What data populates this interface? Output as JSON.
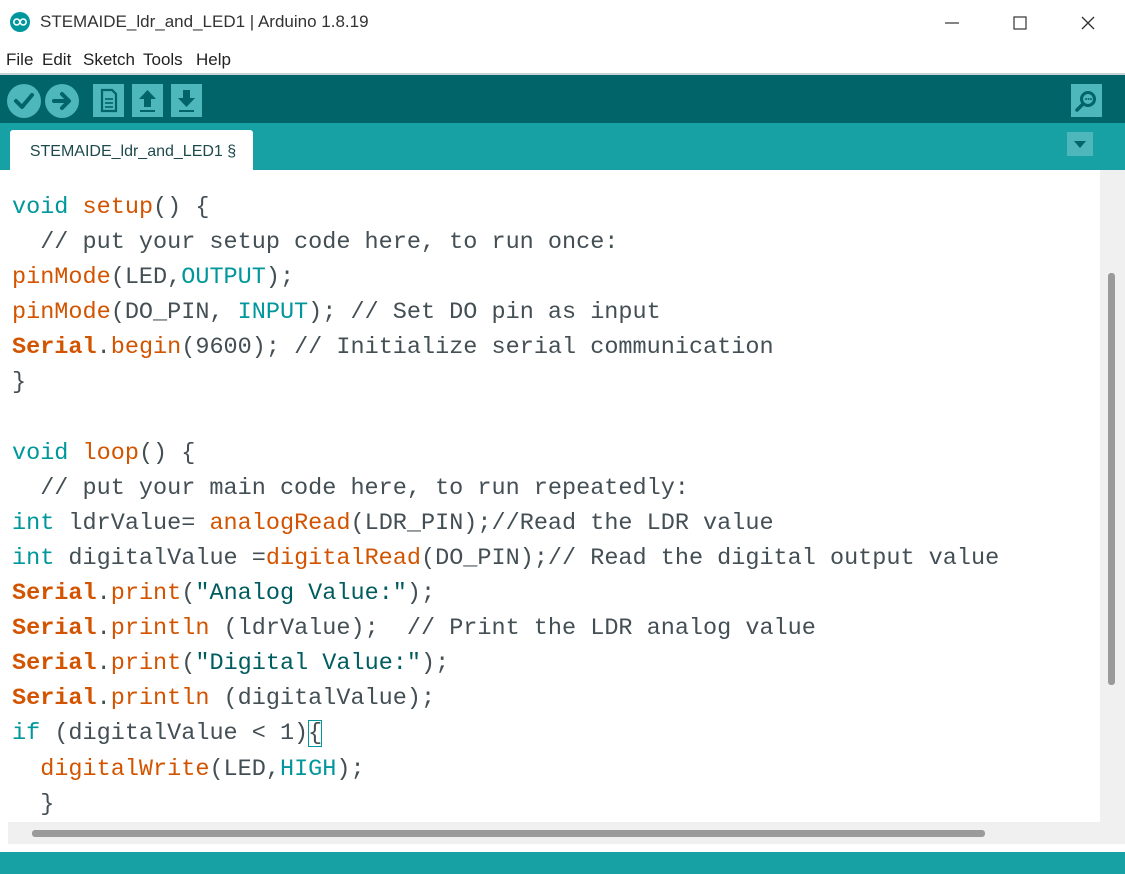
{
  "window": {
    "title": "STEMAIDE_ldr_and_LED1 | Arduino 1.8.19",
    "app_icon": "arduino-icon",
    "controls": [
      "minimize-icon",
      "maximize-icon",
      "close-icon"
    ]
  },
  "menubar": {
    "items": [
      "File",
      "Edit",
      "Sketch",
      "Tools",
      "Help"
    ]
  },
  "toolbar": {
    "buttons": [
      "verify-icon",
      "upload-icon",
      "new-icon",
      "open-icon",
      "save-icon"
    ],
    "right_button": "serial-monitor-icon"
  },
  "tabs": [
    {
      "label": "STEMAIDE_ldr_and_LED1 §",
      "active": true
    }
  ],
  "tab_menu_icon": "chevron-down-icon",
  "editor": {
    "lines": [
      [
        {
          "t": "void",
          "c": "kw"
        },
        {
          "t": " "
        },
        {
          "t": "setup",
          "c": "fn"
        },
        {
          "t": "() {"
        }
      ],
      [
        {
          "t": "  // put your setup code here, to run once:",
          "c": "cm"
        }
      ],
      [
        {
          "t": "pinMode",
          "c": "fn"
        },
        {
          "t": "(LED,"
        },
        {
          "t": "OUTPUT",
          "c": "kw"
        },
        {
          "t": ");"
        }
      ],
      [
        {
          "t": "pinMode",
          "c": "fn"
        },
        {
          "t": "(DO_PIN, "
        },
        {
          "t": "INPUT",
          "c": "kw"
        },
        {
          "t": "); "
        },
        {
          "t": "// Set DO pin as input",
          "c": "cm"
        }
      ],
      [
        {
          "t": "Serial",
          "c": "obj"
        },
        {
          "t": "."
        },
        {
          "t": "begin",
          "c": "fn"
        },
        {
          "t": "(9600); "
        },
        {
          "t": "// Initialize serial communication",
          "c": "cm"
        }
      ],
      [
        {
          "t": "}"
        }
      ],
      [
        {
          "t": ""
        }
      ],
      [
        {
          "t": "void",
          "c": "kw"
        },
        {
          "t": " "
        },
        {
          "t": "loop",
          "c": "fn"
        },
        {
          "t": "() {"
        }
      ],
      [
        {
          "t": "  // put your main code here, to run repeatedly:",
          "c": "cm"
        }
      ],
      [
        {
          "t": "int",
          "c": "kw"
        },
        {
          "t": " ldrValue= "
        },
        {
          "t": "analogRead",
          "c": "fn"
        },
        {
          "t": "(LDR_PIN);"
        },
        {
          "t": "//Read the LDR value",
          "c": "cm"
        }
      ],
      [
        {
          "t": "int",
          "c": "kw"
        },
        {
          "t": " digitalValue ="
        },
        {
          "t": "digitalRead",
          "c": "fn"
        },
        {
          "t": "(DO_PIN);"
        },
        {
          "t": "// Read the digital output value",
          "c": "cm"
        }
      ],
      [
        {
          "t": "Serial",
          "c": "obj"
        },
        {
          "t": "."
        },
        {
          "t": "print",
          "c": "fn"
        },
        {
          "t": "("
        },
        {
          "t": "\"Analog Value:\"",
          "c": "st"
        },
        {
          "t": ");"
        }
      ],
      [
        {
          "t": "Serial",
          "c": "obj"
        },
        {
          "t": "."
        },
        {
          "t": "println",
          "c": "fn"
        },
        {
          "t": " (ldrValue);  "
        },
        {
          "t": "// Print the LDR analog value",
          "c": "cm"
        }
      ],
      [
        {
          "t": "Serial",
          "c": "obj"
        },
        {
          "t": "."
        },
        {
          "t": "print",
          "c": "fn"
        },
        {
          "t": "("
        },
        {
          "t": "\"Digital Value:\"",
          "c": "st"
        },
        {
          "t": ");"
        }
      ],
      [
        {
          "t": "Serial",
          "c": "obj"
        },
        {
          "t": "."
        },
        {
          "t": "println",
          "c": "fn"
        },
        {
          "t": " (digitalValue);"
        }
      ],
      [
        {
          "t": "if",
          "c": "kw"
        },
        {
          "t": " (digitalValue < 1)"
        },
        {
          "t": "{",
          "c": "brace"
        }
      ],
      [
        {
          "t": "  "
        },
        {
          "t": "digitalWrite",
          "c": "fn"
        },
        {
          "t": "(LED,"
        },
        {
          "t": "HIGH",
          "c": "kw"
        },
        {
          "t": ");"
        }
      ],
      [
        {
          "t": "  }"
        }
      ]
    ]
  },
  "colors": {
    "toolbar": "#006468",
    "tabbar": "#17a1a5",
    "button": "#4db7bb",
    "keyword": "#00979c",
    "function": "#d35400",
    "text": "#434f54"
  }
}
